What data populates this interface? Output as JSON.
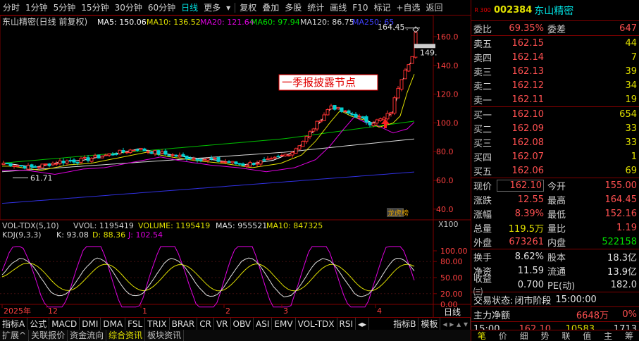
{
  "toolbar": {
    "left_items": [
      "分时",
      "1分钟",
      "5分钟",
      "15分钟",
      "30分钟",
      "60分钟",
      "日线",
      "更多"
    ],
    "active": "日线",
    "right_items": [
      "复权",
      "叠加",
      "多股",
      "统计",
      "画线",
      "F10",
      "标记",
      "+自选",
      "返回"
    ]
  },
  "chart_header": {
    "title": "东山精密(日线 前复权)",
    "ma": [
      {
        "label": "MA5: 150.06",
        "color": "#ffffff"
      },
      {
        "label": "MA10: 136.52",
        "color": "#e0e000"
      },
      {
        "label": "MA20: 121.64",
        "color": "#e000e0"
      },
      {
        "label": "MA60: 97.94",
        "color": "#00e000"
      },
      {
        "label": "MA120: 86.75",
        "color": "#d8d8d8"
      },
      {
        "label": "MA250: 65",
        "color": "#4040ff"
      }
    ]
  },
  "annotation": "一季报披露节点",
  "badge_lhb": "龙虎榜",
  "price_labels": {
    "high": "164.45",
    "low": "61.71",
    "current": "149."
  },
  "y_axis": [
    "160.0",
    "140.0",
    "120.0",
    "100.0",
    "80.0",
    "60.0",
    "40.0"
  ],
  "vol_header": {
    "name": "VOL-TDX(5,10)",
    "vvol": "VVOL: 1195419",
    "volume": "VOLUME: 1195419",
    "ma5": "MA5: 955521",
    "ma10": "MA10: 847325",
    "unit": "X100"
  },
  "kdj_header": {
    "name": "KDJ(9,3,3)",
    "k": "K: 93.08",
    "d": "D: 88.36",
    "j": "J: 102.54"
  },
  "kdj_axis": [
    "100.00",
    "80.00",
    "50.00",
    "20.00",
    "0.00"
  ],
  "x_axis": [
    "2025年",
    "12",
    "1",
    "2",
    "3",
    "4"
  ],
  "period_label": "日线",
  "indicator_tabs": [
    "指标A",
    "公式",
    "MACD",
    "DMI",
    "DMA",
    "FSL",
    "TRIX",
    "BRAR",
    "CR",
    "VR",
    "OBV",
    "ASI",
    "EMV",
    "VOL-TDX",
    "RSI"
  ],
  "indicator_tabs_right": [
    "指标B",
    "模板"
  ],
  "info_tabs": [
    "扩展^",
    "关联报价",
    "资金流向",
    "综合资讯",
    "板块资讯"
  ],
  "info_active": "综合资讯",
  "quote": {
    "badge": "R 300",
    "code": "002384",
    "name": "东山精密",
    "weibi_label": "委比",
    "weibi": "69.35%",
    "weicha_label": "委差",
    "weicha": "647",
    "asks": [
      {
        "label": "卖五",
        "price": "162.15",
        "vol": "44"
      },
      {
        "label": "卖四",
        "price": "162.14",
        "vol": "7"
      },
      {
        "label": "卖三",
        "price": "162.13",
        "vol": "39"
      },
      {
        "label": "卖二",
        "price": "162.12",
        "vol": "34"
      },
      {
        "label": "卖一",
        "price": "162.11",
        "vol": "19"
      }
    ],
    "bids": [
      {
        "label": "买一",
        "price": "162.10",
        "vol": "654"
      },
      {
        "label": "买二",
        "price": "162.09",
        "vol": "33"
      },
      {
        "label": "买三",
        "price": "162.08",
        "vol": "33"
      },
      {
        "label": "买四",
        "price": "162.07",
        "vol": "1"
      },
      {
        "label": "买五",
        "price": "162.06",
        "vol": "69"
      }
    ],
    "stats1": [
      {
        "l1": "现价",
        "v1": "162.10",
        "c1": "red",
        "l2": "今开",
        "v2": "155.00",
        "c2": "red"
      },
      {
        "l1": "涨跌",
        "v1": "12.55",
        "c1": "red",
        "l2": "最高",
        "v2": "164.45",
        "c2": "red"
      },
      {
        "l1": "涨幅",
        "v1": "8.39%",
        "c1": "red",
        "l2": "最低",
        "v2": "152.16",
        "c2": "red"
      },
      {
        "l1": "总量",
        "v1": "119.5万",
        "c1": "yellow",
        "l2": "量比",
        "v2": "1.19",
        "c2": "red"
      },
      {
        "l1": "外盘",
        "v1": "673261",
        "c1": "red",
        "l2": "内盘",
        "v2": "522158",
        "c2": "green"
      }
    ],
    "stats2": [
      {
        "l1": "换手",
        "v1": "8.62%",
        "c1": "white",
        "l2": "股本",
        "v2": "18.3亿",
        "c2": "white"
      },
      {
        "l1": "净资",
        "v1": "11.59",
        "c1": "white",
        "l2": "流通",
        "v2": "13.9亿",
        "c2": "white"
      },
      {
        "l1": "收益㈢",
        "v1": "0.700",
        "c1": "white",
        "l2": "PE(动)",
        "v2": "182.0",
        "c2": "white"
      }
    ],
    "status_label": "交易状态:",
    "status": "闭市阶段",
    "status_time": "15:00:00",
    "netflow_label": "主力净额",
    "netflow": "6648万",
    "netflow_pct": "0%",
    "tick_time": "15:00",
    "tick_price": "162.10",
    "tick_vol": "10583",
    "tick_count": "1713",
    "nav": [
      "笔",
      "价",
      "细",
      "势",
      "联",
      "值",
      "主",
      "筹"
    ],
    "nav_active": "笔"
  }
}
